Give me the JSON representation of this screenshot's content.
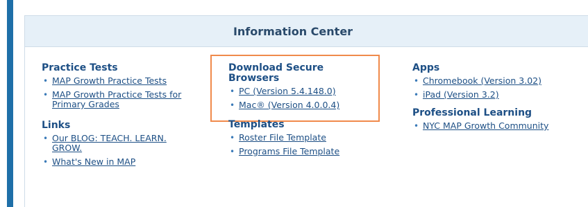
{
  "header": {
    "title": "Information Center"
  },
  "sections": {
    "practice_tests": {
      "title": "Practice Tests",
      "items": [
        "MAP Growth Practice Tests",
        "MAP Growth Practice Tests for Primary Grades"
      ]
    },
    "links": {
      "title": "Links",
      "items": [
        "Our BLOG: TEACH. LEARN. GROW.",
        "What's New in MAP"
      ]
    },
    "download_browsers": {
      "title": "Download Secure Browsers",
      "items": [
        "PC (Version 5.4.148.0)",
        "Mac® (Version 4.0.0.4)"
      ]
    },
    "templates": {
      "title": "Templates",
      "items": [
        "Roster File Template",
        "Programs File Template"
      ]
    },
    "apps": {
      "title": "Apps",
      "items": [
        "Chromebook (Version 3.02)",
        "iPad (Version 3.2)"
      ]
    },
    "professional_learning": {
      "title": "Professional Learning",
      "items": [
        "NYC MAP Growth Community"
      ]
    }
  },
  "colors": {
    "accent": "#1d4f85",
    "highlight_border": "#f08a4b",
    "header_bg": "#e6f0f8",
    "rail": "#1f6fa8"
  }
}
